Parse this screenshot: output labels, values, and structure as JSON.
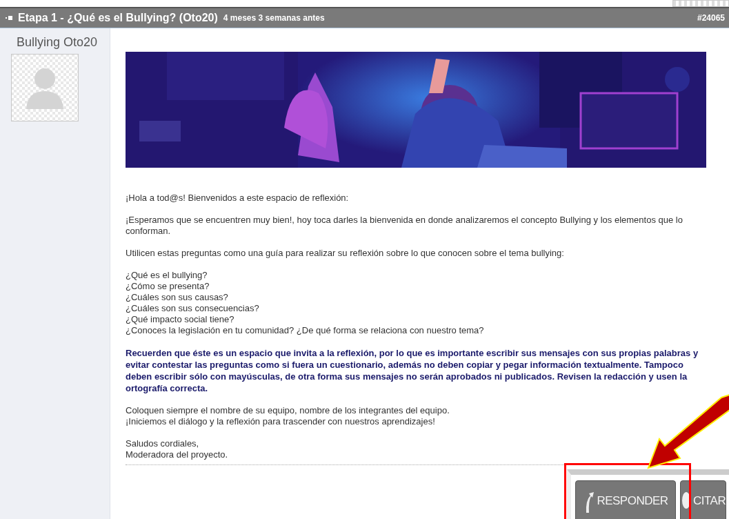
{
  "post": {
    "title": "Etapa 1 - ¿Qué es el Bullying? (Oto20)",
    "time": "4 meses 3 semanas antes",
    "number": "#24065"
  },
  "author": {
    "name": "Bullying Oto20"
  },
  "paragraphs": [
    {
      "kind": "text",
      "lines": [
        "¡Hola a tod@s! Bienvenidos a este espacio de reflexión:"
      ]
    },
    {
      "kind": "text",
      "lines": [
        "¡Esperamos que se encuentren muy bien!, hoy toca darles la bienvenida en donde analizaremos el concepto Bullying y los elementos que lo conforman."
      ]
    },
    {
      "kind": "text",
      "lines": [
        "Utilicen estas preguntas como una guía para realizar su reflexión sobre lo que conocen sobre el tema bullying:"
      ]
    },
    {
      "kind": "text",
      "lines": [
        "¿Qué es el bullying?",
        "¿Cómo se presenta?",
        "¿Cuáles son sus causas?",
        "¿Cuáles son sus consecuencias?",
        "¿Qué impacto social tiene?",
        "¿Conoces la legislación en tu comunidad? ¿De qué forma se relaciona con nuestro tema?"
      ]
    },
    {
      "kind": "bold",
      "lines": [
        "Recuerden que éste es un espacio que invita a la reflexión, por lo que es importante escribir sus mensajes con sus propias palabras y evitar contestar las preguntas como si fuera un cuestionario, además no deben copiar y pegar información textualmente. Tampoco deben escribir sólo con mayúsculas, de otra forma sus mensajes no serán aprobados ni publicados. Revisen la redacción y usen la ortografía correcta."
      ]
    },
    {
      "kind": "text",
      "lines": [
        "Coloquen siempre el nombre de su equipo, nombre de los integrantes del equipo.",
        "¡Iniciemos el diálogo y la reflexión para trascender con nuestros aprendizajes!"
      ]
    },
    {
      "kind": "text",
      "lines": [
        "Saludos cordiales,",
        "Moderadora del proyecto."
      ]
    }
  ],
  "buttons": [
    {
      "label": "RESPONDER",
      "kind": "reply"
    },
    {
      "label": "CITAR",
      "kind": "quote"
    }
  ]
}
